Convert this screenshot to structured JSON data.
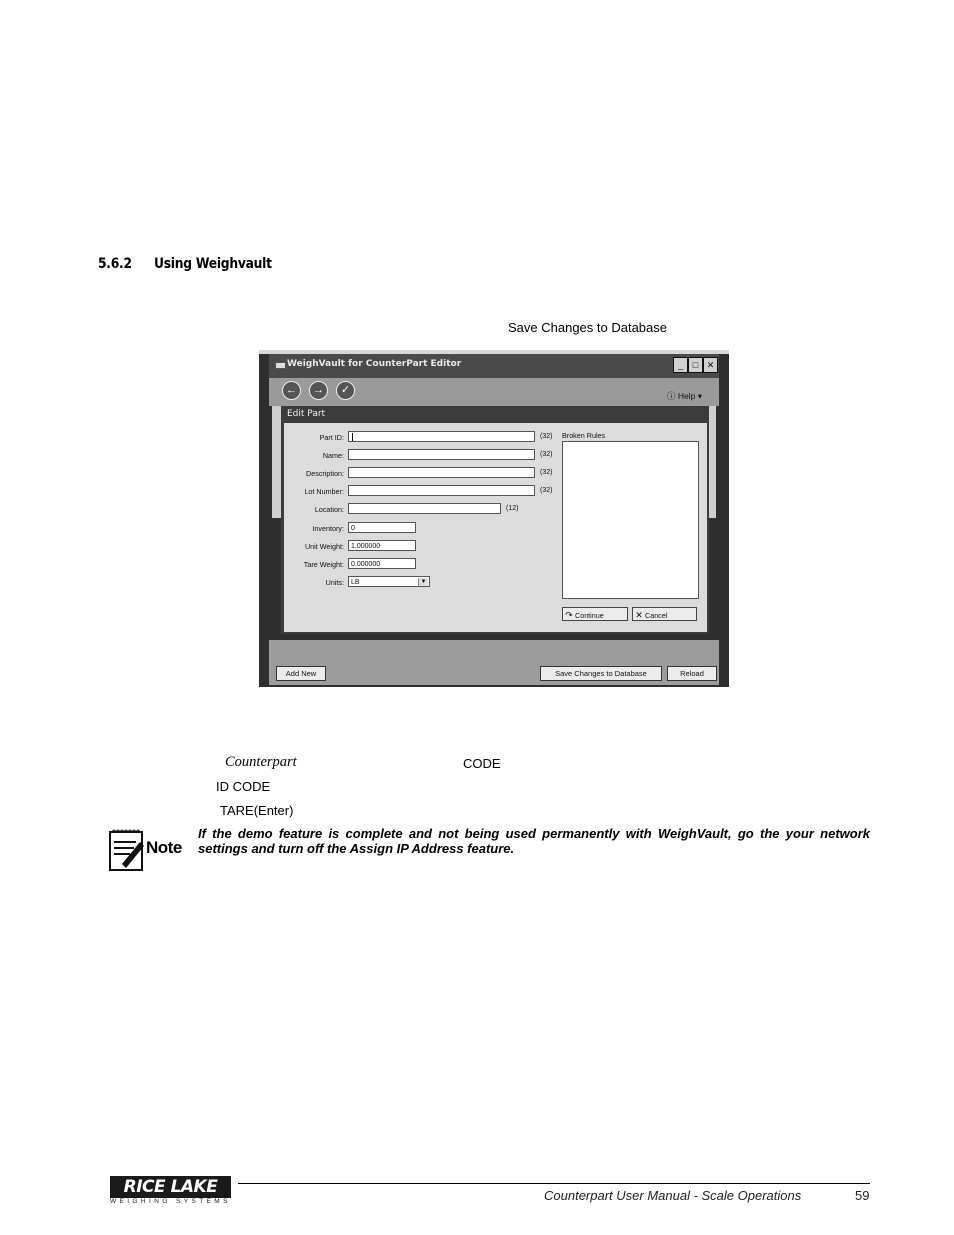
{
  "section": {
    "number": "5.6.2",
    "title": "Using Weighvault"
  },
  "lead_text": "Save Changes to Database",
  "screenshot": {
    "window_title": "WeighVault for CounterPart Editor",
    "window_buttons": [
      "_",
      "□",
      "✕"
    ],
    "help_label": "Help",
    "dialog_title": "Edit Part",
    "fields": [
      {
        "label": "Part ID:",
        "value": "",
        "length": "(32)"
      },
      {
        "label": "Name:",
        "value": "",
        "length": "(32)"
      },
      {
        "label": "Description:",
        "value": "",
        "length": "(32)"
      },
      {
        "label": "Lot Number:",
        "value": "",
        "length": "(32)"
      },
      {
        "label": "Location:",
        "value": "",
        "length": "(12)"
      },
      {
        "label": "Inventory:",
        "value": "0",
        "length": ""
      },
      {
        "label": "Unit Weight:",
        "value": "1.000000",
        "length": ""
      },
      {
        "label": "Tare Weight:",
        "value": "0.000000",
        "length": ""
      },
      {
        "label": "Units:",
        "value": "LB",
        "length": ""
      }
    ],
    "broken_rules_label": "Broken Rules",
    "continue_label": "Continue",
    "cancel_label": "Cancel",
    "add_new_label": "Add New",
    "save_label": "Save Changes to Database",
    "reload_label": "Reload"
  },
  "body": {
    "italic_word": "Counterpart",
    "code_1": "CODE",
    "code_2": "ID CODE",
    "code_3": "TARE(Enter)"
  },
  "note": {
    "label": "Note",
    "text": "If the demo feature is complete and not being used permanently with WeighVault, go the your network settings and turn off the Assign IP Address feature."
  },
  "footer": {
    "logo": "RICE LAKE",
    "logo_sub": "WEIGHING SYSTEMS",
    "title": "Counterpart User Manual - Scale Operations",
    "page": "59"
  }
}
